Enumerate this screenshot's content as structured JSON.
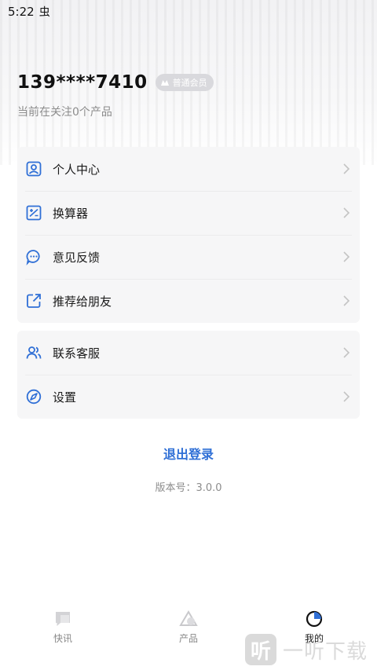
{
  "status_bar": {
    "time": "5:22",
    "carrier_glyph": "虫"
  },
  "profile": {
    "phone": "139****7410",
    "badge": "普通会员",
    "follow_text": "当前在关注0个产品"
  },
  "menu_group_1": [
    {
      "label": "个人中心",
      "icon": "user-profile-icon"
    },
    {
      "label": "换算器",
      "icon": "calculator-icon"
    },
    {
      "label": "意见反馈",
      "icon": "feedback-chat-icon"
    },
    {
      "label": "推荐给朋友",
      "icon": "share-external-icon"
    }
  ],
  "menu_group_2": [
    {
      "label": "联系客服",
      "icon": "customer-service-icon"
    },
    {
      "label": "设置",
      "icon": "settings-icon"
    }
  ],
  "logout_label": "退出登录",
  "version_text": "版本号：3.0.0",
  "tabs": [
    {
      "label": "快讯",
      "icon": "news-icon",
      "active": false
    },
    {
      "label": "产品",
      "icon": "product-icon",
      "active": false
    },
    {
      "label": "我的",
      "icon": "me-icon",
      "active": true
    }
  ],
  "watermark": {
    "glyph": "听",
    "text": "一听下载"
  },
  "colors": {
    "accent": "#2f6fd6",
    "card_bg": "#f6f6f7",
    "muted_text": "#8c8c8c"
  }
}
